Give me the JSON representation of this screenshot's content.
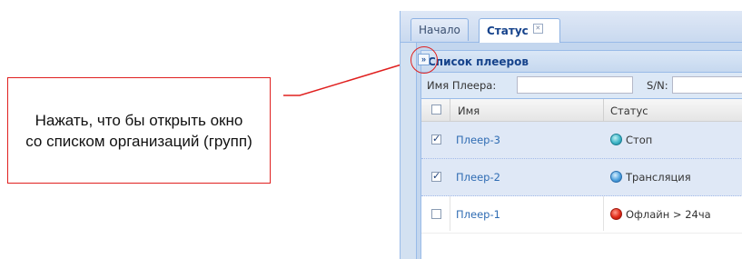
{
  "callout": {
    "text": "Нажать, что бы открыть окно со списком организаций (групп)",
    "border_color": "#e0201f"
  },
  "tabs": [
    {
      "label": "Начало",
      "active": false
    },
    {
      "label": "Статус",
      "active": true,
      "close_icon": "close-icon"
    }
  ],
  "sidebar": {
    "expand_icon": "double-chevron-right-icon",
    "expand_glyph": "»"
  },
  "panel": {
    "title": "Список плееров",
    "filters": {
      "name_label": "Имя Плеера:",
      "sn_label": "S/N:"
    },
    "columns": [
      "Имя",
      "Статус"
    ],
    "rows": [
      {
        "name": "Плеер-3",
        "status": "Стоп",
        "status_icon": "teal-status-icon",
        "checked": true,
        "selected": true
      },
      {
        "name": "Плеер-2",
        "status": "Трансляция",
        "status_icon": "blue-status-icon",
        "checked": true,
        "selected": true
      },
      {
        "name": "Плеер-1",
        "status": "Офлайн > 24ча",
        "status_icon": "red-status-icon",
        "checked": false,
        "selected": false
      }
    ]
  },
  "colors": {
    "accent": "#15428b",
    "link": "#2f6cb3",
    "selected_row": "#dfe8f6",
    "annotation": "#e0201f"
  }
}
